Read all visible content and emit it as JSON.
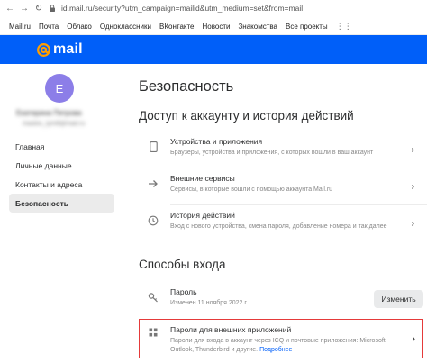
{
  "browser": {
    "url": "id.mail.ru/security?utm_campaign=mailid&utm_medium=set&from=mail"
  },
  "portal": {
    "links": [
      "Mail.ru",
      "Почта",
      "Облако",
      "Одноклассники",
      "ВКонтакте",
      "Новости",
      "Знакомства",
      "Все проекты"
    ]
  },
  "header": {
    "logo_text": "mail"
  },
  "user": {
    "avatar_letter": "E",
    "name": "Екатерина Петрова",
    "email": "maslov_tym8@mail.ru"
  },
  "sidebar": {
    "items": [
      {
        "label": "Главная"
      },
      {
        "label": "Личные данные"
      },
      {
        "label": "Контакты и адреса"
      },
      {
        "label": "Безопасность"
      }
    ],
    "active_index": 3
  },
  "page": {
    "title": "Безопасность",
    "access_section": {
      "title": "Доступ к аккаунту и история действий",
      "rows": [
        {
          "title": "Устройства и приложения",
          "subtitle": "Браузеры, устройства и приложения, с которых вошли в ваш аккаунт",
          "icon": "phone-icon"
        },
        {
          "title": "Внешние сервисы",
          "subtitle": "Сервисы, в которые вошли с помощью аккаунта Mail.ru",
          "icon": "external-icon"
        },
        {
          "title": "История действий",
          "subtitle": "Вход с нового устройства, смена пароля, добавление номера и так далее",
          "icon": "history-icon"
        }
      ]
    },
    "login_section": {
      "title": "Способы входа",
      "password": {
        "title": "Пароль",
        "subtitle": "Изменен 11 ноября 2022 г.",
        "button": "Изменить",
        "icon": "key-icon"
      },
      "app_passwords": {
        "title": "Пароли для внешних приложений",
        "subtitle": "Пароли для входа в аккаунт через ICQ и почтовые приложения: Microsoft Outlook, Thunderbird и другие.",
        "link": "Подробнее",
        "icon": "apps-grid-icon"
      }
    }
  },
  "colors": {
    "brand": "#005ff9",
    "highlight": "#e53a3a",
    "avatar": "#8c7ee8"
  }
}
